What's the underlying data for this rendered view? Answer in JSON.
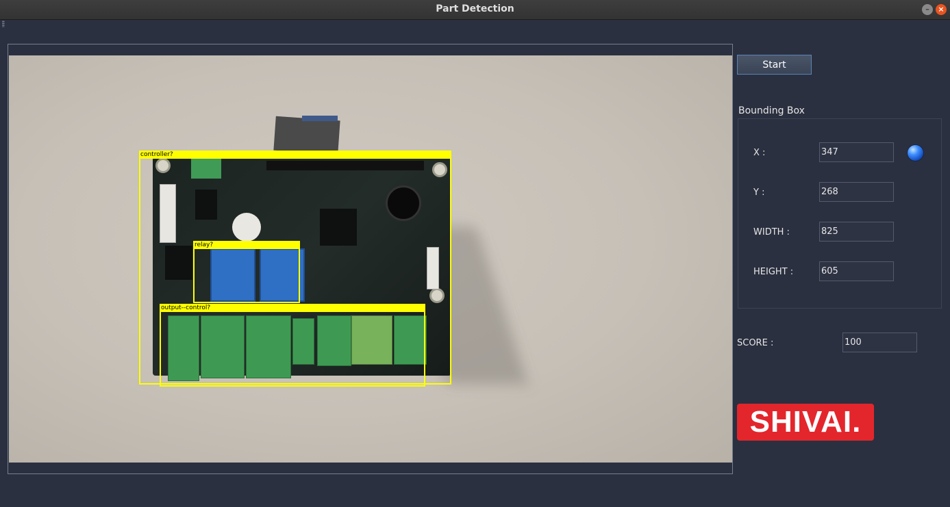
{
  "window": {
    "title": "Part Detection"
  },
  "controls": {
    "start_label": "Start",
    "bounding_box_title": "Bounding Box",
    "x_label": "X :",
    "y_label": "Y :",
    "width_label": "WIDTH :",
    "height_label": "HEIGHT :",
    "x_value": "347",
    "y_value": "268",
    "width_value": "825",
    "height_value": "605",
    "score_label": "SCORE :",
    "score_value": "100",
    "status_led_color": "#2f7cff"
  },
  "detections": [
    {
      "label": "controller?"
    },
    {
      "label": "relay?"
    },
    {
      "label": "output--control?"
    }
  ],
  "logo": {
    "text": "SHIVAI."
  },
  "colors": {
    "detection_box": "#ffff00",
    "logo_bg": "#e3262c",
    "background": "#2b3040"
  }
}
